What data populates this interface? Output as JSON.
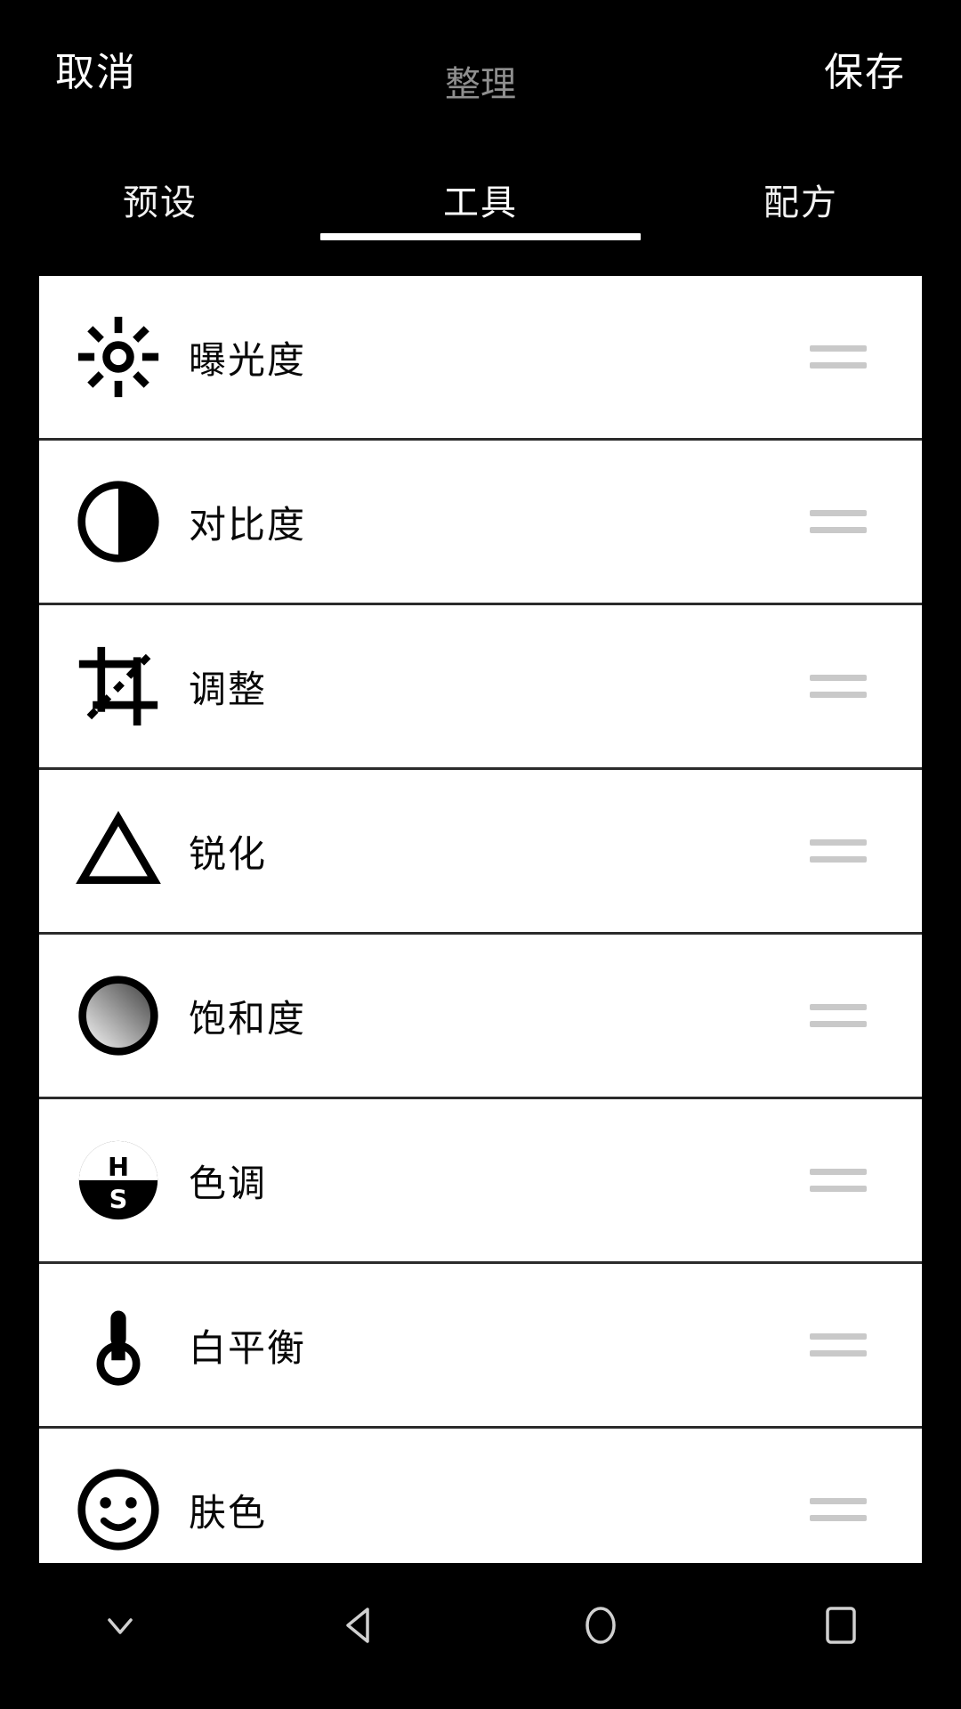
{
  "app": {
    "name": "Photo Editor",
    "background_color": "#000000",
    "panel_color": "#ffffff",
    "accent_color": "#ffffff",
    "muted_text_color": "#8f8f8f"
  },
  "topbar": {
    "cancel_label": "取消",
    "title": "整理",
    "save_label": "保存"
  },
  "tabs": {
    "items": [
      {
        "label": "预设",
        "active": false
      },
      {
        "label": "工具",
        "active": true
      },
      {
        "label": "配方",
        "active": false
      }
    ],
    "active_index": 1
  },
  "tools": {
    "items": [
      {
        "label": "曝光度",
        "icon": "brightness-sun-icon",
        "handle": "drag-handle-icon"
      },
      {
        "label": "对比度",
        "icon": "contrast-half-circle-icon",
        "handle": "drag-handle-icon"
      },
      {
        "label": "调整",
        "icon": "crop-transform-icon",
        "handle": "drag-handle-icon"
      },
      {
        "label": "锐化",
        "icon": "sharpen-triangle-icon",
        "handle": "drag-handle-icon"
      },
      {
        "label": "饱和度",
        "icon": "saturation-gradient-circle-icon",
        "handle": "drag-handle-icon"
      },
      {
        "label": "色调",
        "icon": "hue-saturation-hs-icon",
        "handle": "drag-handle-icon"
      },
      {
        "label": "白平衡",
        "icon": "white-balance-thermometer-icon",
        "handle": "drag-handle-icon"
      },
      {
        "label": "肤色",
        "icon": "skin-tone-face-icon",
        "handle": "drag-handle-icon"
      }
    ]
  },
  "navbar": {
    "items": [
      {
        "icon": "chevron-down-icon",
        "name": "hide-nav-button"
      },
      {
        "icon": "back-triangle-icon",
        "name": "back-button"
      },
      {
        "icon": "home-circle-icon",
        "name": "home-button"
      },
      {
        "icon": "recents-square-icon",
        "name": "recents-button"
      }
    ]
  }
}
